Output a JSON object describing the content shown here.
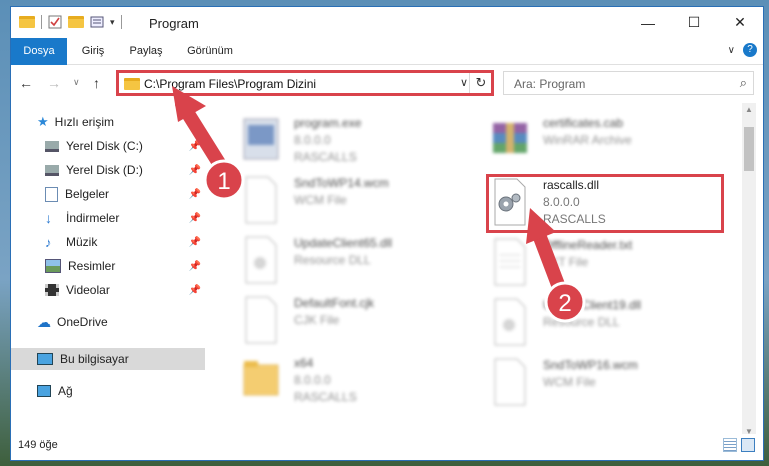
{
  "window": {
    "title": "Program",
    "controls": {
      "minimize": "—",
      "maximize": "☐",
      "close": "✕"
    }
  },
  "ribbon": {
    "tabs": [
      "Dosya",
      "Giriş",
      "Paylaş",
      "Görünüm"
    ],
    "help": "?"
  },
  "nav": {
    "back": "←",
    "forward": "→",
    "recent": "∨",
    "up": "↑",
    "address": "C:\\Program Files\\Program Dizini",
    "address_chevron": "∨",
    "refresh": "↻",
    "search_placeholder": "Ara: Program",
    "search_icon": "⌕"
  },
  "sidebar": {
    "items": [
      {
        "label": "Hızlı erişim",
        "icon": "star-icon",
        "pinned": false
      },
      {
        "label": "Yerel Disk (C:)",
        "icon": "drive-icon",
        "pinned": true
      },
      {
        "label": "Yerel Disk (D:)",
        "icon": "drive-icon",
        "pinned": true
      },
      {
        "label": "Belgeler",
        "icon": "documents-icon",
        "pinned": true
      },
      {
        "label": "İndirmeler",
        "icon": "download-icon",
        "pinned": true
      },
      {
        "label": "Müzik",
        "icon": "music-icon",
        "pinned": true
      },
      {
        "label": "Resimler",
        "icon": "pictures-icon",
        "pinned": true
      },
      {
        "label": "Videolar",
        "icon": "video-icon",
        "pinned": true
      },
      {
        "label": "OneDrive",
        "icon": "cloud-icon",
        "pinned": false
      },
      {
        "label": "Bu bilgisayar",
        "icon": "computer-icon",
        "pinned": false
      },
      {
        "label": "Ağ",
        "icon": "network-icon",
        "pinned": false
      }
    ],
    "pin_glyph": "📌"
  },
  "files": [
    {
      "name": "program.exe",
      "line2": "8.0.0.0",
      "line3": "RASCALLS",
      "icon": "exe-icon"
    },
    {
      "name": "certificates.cab",
      "line2": "WinRAR Archive",
      "line3": "",
      "icon": "archive-icon"
    },
    {
      "name": "SndToWP14.wcm",
      "line2": "WCM File",
      "line3": "",
      "icon": "file-icon"
    },
    {
      "name": "rascalls.dll",
      "line2": "8.0.0.0",
      "line3": "RASCALLS",
      "icon": "dll-gear-icon"
    },
    {
      "name": "UpdateClient65.dll",
      "line2": "Resource DLL",
      "line3": "",
      "icon": "dll-icon"
    },
    {
      "name": "OfflineReader.txt",
      "line2": "TXT File",
      "line3": "",
      "icon": "text-file-icon"
    },
    {
      "name": "DefaultFont.cjk",
      "line2": "CJK File",
      "line3": "",
      "icon": "file-icon"
    },
    {
      "name": "UpdateClient19.dll",
      "line2": "Resource DLL",
      "line3": "",
      "icon": "dll-icon"
    },
    {
      "name": "x64",
      "line2": "8.0.0.0",
      "line3": "RASCALLS",
      "icon": "folder-icon"
    },
    {
      "name": "SndToWP16.wcm",
      "line2": "WCM File",
      "line3": "",
      "icon": "file-icon"
    }
  ],
  "status": {
    "count": "149 öğe"
  },
  "annotations": {
    "badge1": "1",
    "badge2": "2"
  },
  "colors": {
    "accent": "#1979ca",
    "highlight": "#d9434b"
  }
}
